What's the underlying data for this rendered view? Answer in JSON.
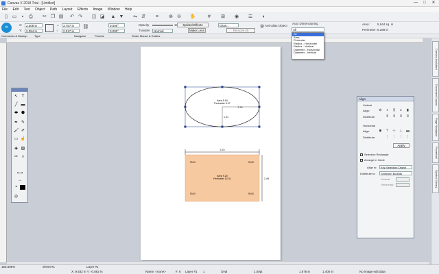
{
  "window": {
    "title": "Canvas X 2018 Trial - [Untitled]",
    "min": "—",
    "max": "□",
    "close": "✕"
  },
  "menu": [
    "File",
    "Edit",
    "Text",
    "Object",
    "Path",
    "Layout",
    "Effects",
    "Image",
    "Window",
    "Help"
  ],
  "props": {
    "x_label": "X:",
    "x_value": "2.308 in",
    "y_label": "Y:",
    "y_value": "2.054 in",
    "w_value": "3.757 in",
    "h_value": "2.017 in",
    "angle1": "0.000°",
    "angle2": "0.000°",
    "opacity_label": "Opacity",
    "opacity_value": "100%",
    "transfer_label": "Transfer",
    "transfer_value": "Normal",
    "sprite_label": "Sprited Effects",
    "make_lens": "Make Lens",
    "glow_label": "Glow...",
    "remove_all": "Remove All",
    "antialias_label": "Anti-alias Object",
    "auto_dim_label": "Auto Dimensioning",
    "auto_dim_value": "All",
    "area_label": "Area:",
    "area_value": "5.944 sq. in",
    "perimeter_label": "Perimeter:",
    "perimeter_value": "9.288 in"
  },
  "dim_options": [
    "All",
    "Area",
    "Perimeter",
    "Radius - Horizontal",
    "Radius - Vertical",
    "Diameter - Horizontal",
    "Diameter - Vertical"
  ],
  "tabs": [
    "Comments & Markup",
    "Type",
    "Navigator",
    "Presets",
    "Smart Mouse & Guides"
  ],
  "dock_tabs": [
    "Canvas Assistant",
    "Document Layout",
    "Page Navigator",
    "Powerball",
    "Symbol Library"
  ],
  "shapes": {
    "ellipse": {
      "area": "Area 5.94",
      "perimeter": "Perimeter 9.27",
      "width": "3.75",
      "height": "1.01"
    },
    "rect": {
      "area": "Area 9.20",
      "perimeter": "Perimeter 12.41",
      "width": "3.70",
      "height": "2.49",
      "angle": "90.00"
    }
  },
  "align_panel": {
    "title": "Align",
    "vertical": "Vertical",
    "horizontal": "Horizontal",
    "align": "Align:",
    "distribute": "Distribute:",
    "apply": "Apply",
    "selection_rect": "Selection Rectangle",
    "arrange_circle": "Arrange in Circle",
    "align_to_label": "Align to:",
    "align_to_value": "Key Selection Object",
    "distribute_to_label": "Distribute to:",
    "distribute_to_value": "Selection Bounds",
    "vertical_field": "Vertical:",
    "horizontal_field": "Horizontal:"
  },
  "status": {
    "zoom": "163.605%",
    "sheet": "Sheet #1",
    "layer": "Layer #1",
    "coords": "X: 9.832 in   Y: -0.862 in",
    "name": "Name: <none>",
    "count": "#: 6",
    "layer2": "Layer #1",
    "num": "1",
    "type": "Oval",
    "stroke": "1.00pt",
    "size": "1.676 in",
    "size2": "1.400 in",
    "message": "No image edit data"
  },
  "colors": {
    "rect_fill": "#f7c9a0",
    "selection_handle": "#1e3a8a"
  }
}
